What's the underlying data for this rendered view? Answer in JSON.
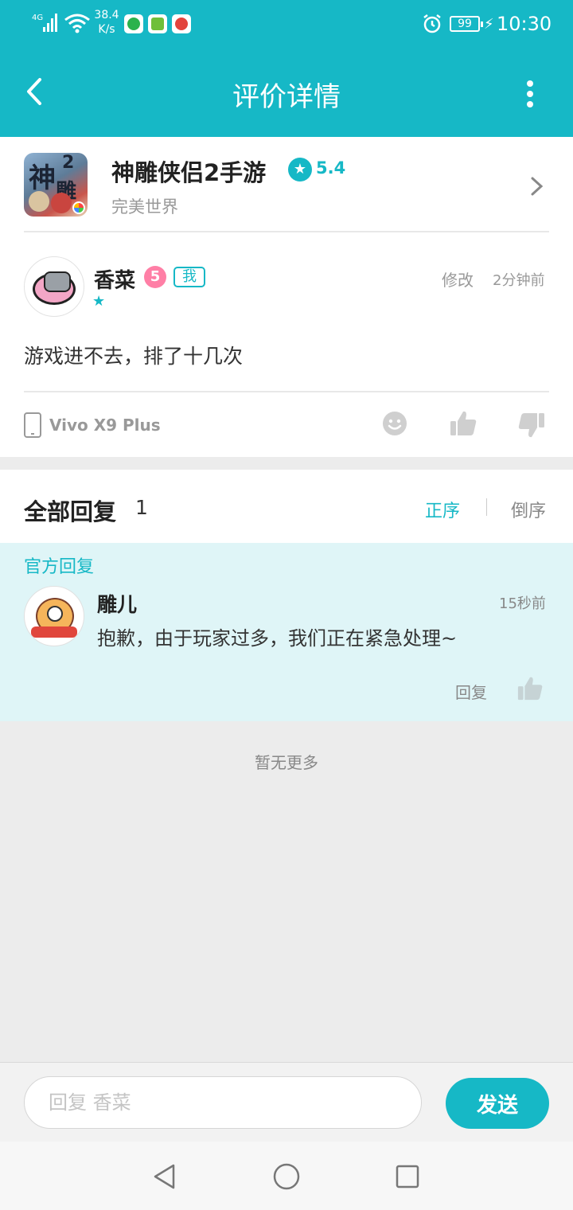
{
  "status_bar": {
    "network": "4G",
    "speed_value": "38.4",
    "speed_unit": "K/s",
    "battery": "99",
    "time": "10:30",
    "icons": [
      "signal-icon",
      "wifi-icon",
      "app-icon",
      "alarm-icon",
      "battery-icon",
      "charging-icon"
    ]
  },
  "header": {
    "title": "评价详情"
  },
  "game": {
    "name": "神雕侠侣2手游",
    "rating": "5.4",
    "developer": "完美世界"
  },
  "review": {
    "user": "香菜",
    "level": "5",
    "me_badge": "我",
    "edit_label": "修改",
    "time": "2分钟前",
    "content": "游戏进不去，排了十几次",
    "device": "Vivo X9 Plus"
  },
  "replies": {
    "title": "全部回复",
    "count": "1",
    "sort_asc": "正序",
    "sort_desc": "倒序",
    "official_label": "官方回复",
    "items": [
      {
        "user": "雕儿",
        "time": "15秒前",
        "content": "抱歉，由于玩家过多，我们正在紧急处理~",
        "reply_label": "回复"
      }
    ],
    "no_more": "暂无更多"
  },
  "input_bar": {
    "placeholder": "回复 香菜",
    "send_label": "发送"
  },
  "colors": {
    "accent": "#16b8c6",
    "official_bg": "#dff5f7"
  }
}
